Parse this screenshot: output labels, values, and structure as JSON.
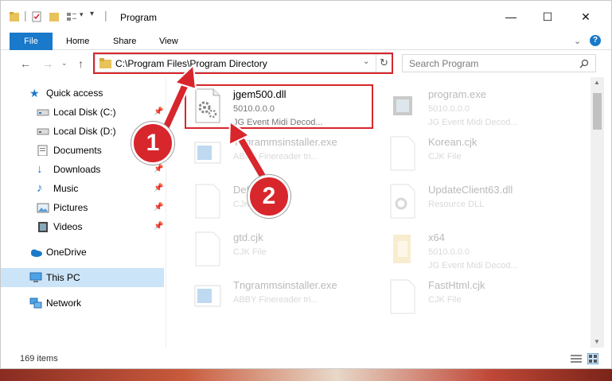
{
  "window": {
    "title": "Program",
    "controls": {
      "minimize": "—",
      "maximize": "☐",
      "close": "✕"
    }
  },
  "ribbon": {
    "tabs": [
      {
        "label": "File"
      },
      {
        "label": "Home"
      },
      {
        "label": "Share"
      },
      {
        "label": "View"
      }
    ]
  },
  "nav": {
    "address": "C:\\Program Files\\Program Directory",
    "search_placeholder": "Search Program"
  },
  "sidebar": {
    "items": [
      {
        "label": "Quick access",
        "icon": "star-icon"
      },
      {
        "label": "Local Disk (C:)",
        "icon": "drive-icon",
        "pinned": true
      },
      {
        "label": "Local Disk (D:)",
        "icon": "drive-icon"
      },
      {
        "label": "Documents",
        "icon": "documents-icon"
      },
      {
        "label": "Downloads",
        "icon": "downloads-icon",
        "pinned": true
      },
      {
        "label": "Music",
        "icon": "music-icon",
        "pinned": true
      },
      {
        "label": "Pictures",
        "icon": "pictures-icon",
        "pinned": true
      },
      {
        "label": "Videos",
        "icon": "videos-icon",
        "pinned": true
      },
      {
        "label": "OneDrive",
        "icon": "onedrive-icon"
      },
      {
        "label": "This PC",
        "icon": "pc-icon",
        "selected": true
      },
      {
        "label": "Network",
        "icon": "network-icon"
      }
    ]
  },
  "files": [
    {
      "name": "jgem500.dll",
      "line2": "5010.0.0.0",
      "line3": "JG Event Midi Decod...",
      "highlighted": true
    },
    {
      "name": "program.exe",
      "line2": "5010.0.0.0",
      "line3": "JG Event Midi Decod..."
    },
    {
      "name": "Tngrammsinstaller.exe",
      "line2": "ABBY Finereader tri..."
    },
    {
      "name": "Korean.cjk",
      "line2": "CJK File"
    },
    {
      "name": "Default.cjk",
      "line2": "CJK File"
    },
    {
      "name": "UpdateClient63.dll",
      "line2": "Resource DLL"
    },
    {
      "name": "gtd.cjk",
      "line2": "CJK File"
    },
    {
      "name": "x64",
      "line2": "5010.0.0.0",
      "line3": "JG Event Midi Decod..."
    },
    {
      "name": "Tngrammsinstaller.exe",
      "line2": "ABBY Finereader tri..."
    },
    {
      "name": "FastHtml.cjk",
      "line2": "CJK File"
    }
  ],
  "status": {
    "count": "169 items"
  },
  "annotations": [
    {
      "label": "1"
    },
    {
      "label": "2"
    }
  ],
  "colors": {
    "accent": "#1979ca",
    "highlight": "#d7262c",
    "selected": "#cce4f7"
  }
}
